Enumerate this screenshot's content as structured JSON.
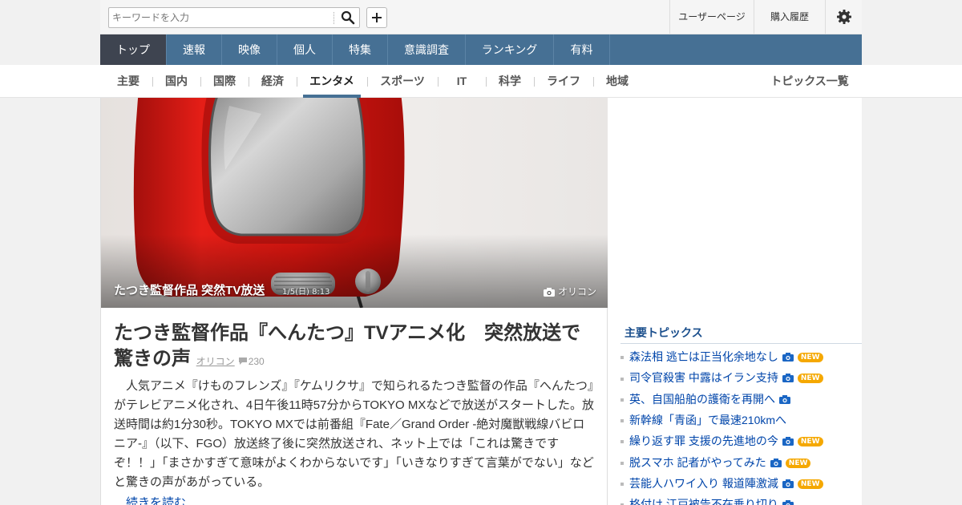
{
  "search": {
    "placeholder": "キーワードを入力"
  },
  "header_links": {
    "user": "ユーザーページ",
    "history": "購入履歴"
  },
  "nav": [
    {
      "label": "トップ"
    },
    {
      "label": "速報"
    },
    {
      "label": "映像"
    },
    {
      "label": "個人"
    },
    {
      "label": "特集"
    },
    {
      "label": "意識調査"
    },
    {
      "label": "ランキング"
    },
    {
      "label": "有料"
    }
  ],
  "subnav": [
    {
      "label": "主要"
    },
    {
      "label": "国内"
    },
    {
      "label": "国際"
    },
    {
      "label": "経済"
    },
    {
      "label": "エンタメ"
    },
    {
      "label": "スポーツ"
    },
    {
      "label": "IT"
    },
    {
      "label": "科学"
    },
    {
      "label": "ライフ"
    },
    {
      "label": "地域"
    }
  ],
  "subnav_right": "トピックス一覧",
  "hero": {
    "caption": "たつき監督作品 突然TV放送",
    "date": "1/5(日) 8:13",
    "credit": "オリコン"
  },
  "article": {
    "title": "たつき監督作品『へんたつ』TVアニメ化　突然放送で驚きの声",
    "source": "オリコン",
    "comments": "230",
    "body": "人気アニメ『けものフレンズ』『ケムリクサ』で知られるたつき監督の作品『へんたつ』がテレビアニメ化され、4日午後11時57分からTOKYO MXなどで放送がスタートした。放送時間は約1分30秒。TOKYO MXでは前番組『Fate／Grand Order -絶対魔獣戦線バビロニア-』（以下、FGO）放送終了後に突然放送され、ネット上では「これは驚きですぞ！！」「まさかすぎて意味がよくわからないです」「いきなりすぎて言葉がでない」などと驚きの声があがっている。",
    "more": "…続きを読む"
  },
  "topics": {
    "title": "主要トピックス",
    "items": [
      {
        "label": "森法相 逃亡は正当化余地なし",
        "camera": true,
        "new": true
      },
      {
        "label": "司令官殺害 中露はイラン支持",
        "camera": true,
        "new": true
      },
      {
        "label": "英、自国船舶の護衛を再開へ",
        "camera": true,
        "new": false
      },
      {
        "label": "新幹線「青函」で最速210kmへ",
        "camera": false,
        "new": false
      },
      {
        "label": "繰り返す罪 支援の先進地の今",
        "camera": true,
        "new": true
      },
      {
        "label": "脱スマホ 記者がやってみた",
        "camera": true,
        "new": true
      },
      {
        "label": "芸能人ハワイ入り 報道陣激減",
        "camera": true,
        "new": true
      },
      {
        "label": "格付け 江戸被告不在乗り切り",
        "camera": true,
        "new": false
      }
    ],
    "new_label": "NEW"
  },
  "colors": {
    "nav_bg": "#467094",
    "nav_active": "#3e4450",
    "link": "#0045aa",
    "new_badge": "#f5a800"
  }
}
